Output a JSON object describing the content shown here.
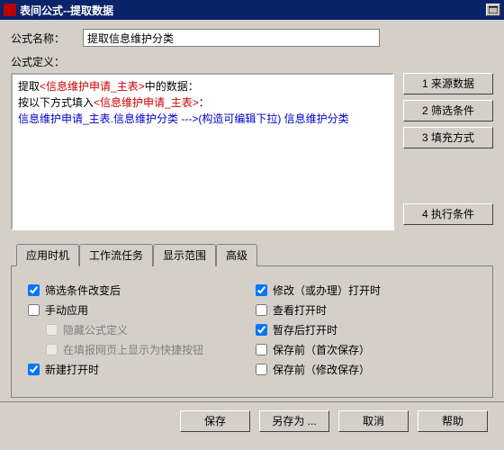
{
  "window": {
    "title": "表间公式--提取数据"
  },
  "form": {
    "name_label": "公式名称：",
    "name_value": "提取信息维护分类",
    "def_label": "公式定义："
  },
  "editor": {
    "l1a": "提取",
    "l1b": "<信息维护申请_主表>",
    "l1c": "中的数据：",
    "l2a": "按以下方式填入",
    "l2b": "<信息维护申请_主表>",
    "l2c": "：",
    "l3": "信息维护申请_主表.信息维护分类  --->(构造可编辑下拉)   信息维护分类"
  },
  "sidebuttons": {
    "b1": "1   来源数据",
    "b2": "2   筛选条件",
    "b3": "3   填充方式",
    "b4": "4   执行条件"
  },
  "tabs": {
    "t1": "应用时机",
    "t2": "工作流任务",
    "t3": "显示范围",
    "t4": "高级"
  },
  "checks": {
    "left": {
      "c1": "筛选条件改变后",
      "c2": "手动应用",
      "c2a": "隐藏公式定义",
      "c2b": "在填报网页上显示为快捷按钮",
      "c3": "新建打开时"
    },
    "right": {
      "r1": "修改（或办理）打开时",
      "r2": "查看打开时",
      "r3": "暂存后打开时",
      "r4": "保存前（首次保存）",
      "r5": "保存前（修改保存）"
    }
  },
  "bottom": {
    "save": "保存",
    "saveas": "另存为 ...",
    "cancel": "取消",
    "help": "帮助"
  }
}
